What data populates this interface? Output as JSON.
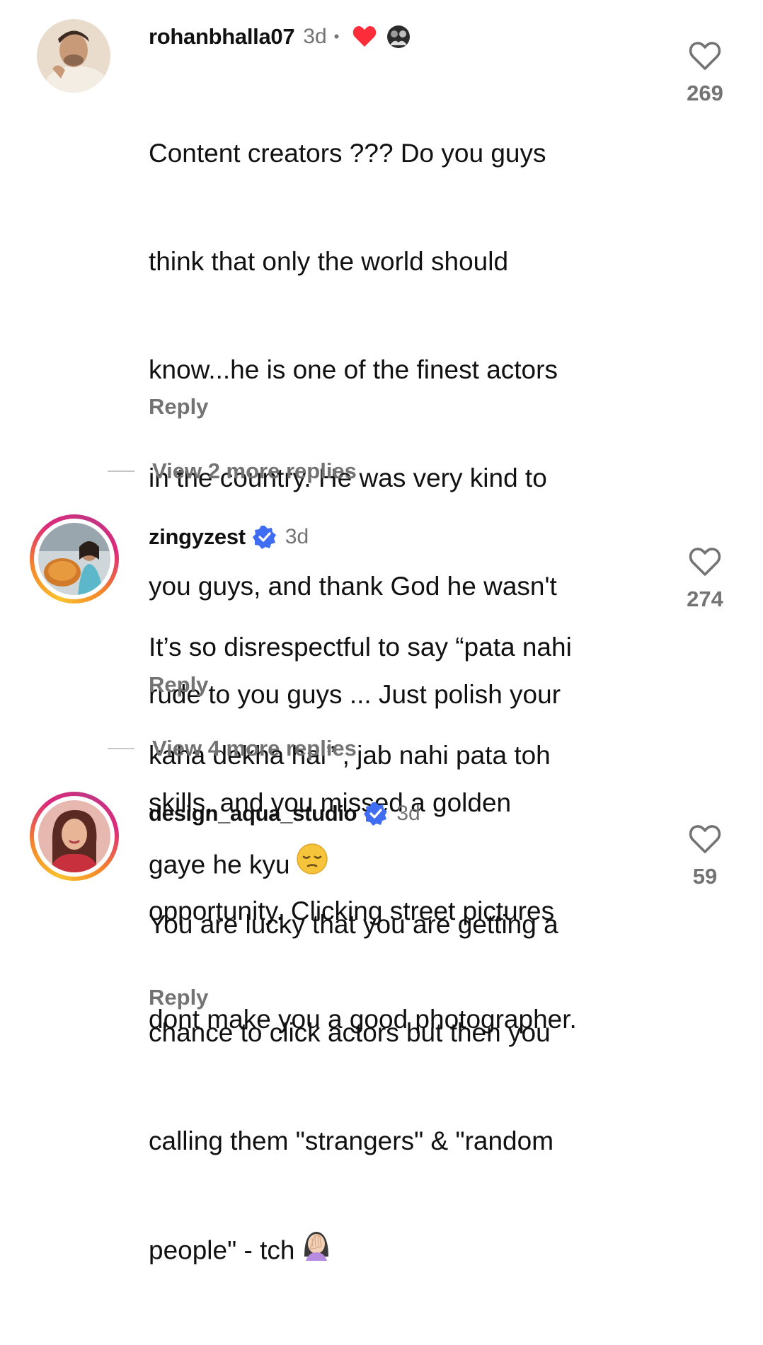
{
  "comments": [
    {
      "username": "rohanbhalla07",
      "time": "3d",
      "dot": "•",
      "lines": [
        "Content creators ??? Do you guys",
        "think that only the world should",
        "know...he is one of the finest actors",
        "in the country. He was very kind to",
        "you guys, and thank God he wasn't",
        "rude to you guys ... Just polish your",
        "skills, and you missed a golden",
        "opportunity. Clicking street pictures",
        "dont make you a good photographer."
      ],
      "reply_label": "Reply",
      "likes": "269",
      "view_replies": "View 2 more replies"
    },
    {
      "username": "zingyzest",
      "time": "3d",
      "lines": [
        "It’s so disrespectful to say “pata nahi",
        "kaha dekha hai” , jab nahi pata toh",
        "gaye he kyu"
      ],
      "emoji": "pensive-face-emoji",
      "reply_label": "Reply",
      "likes": "274",
      "view_replies": "View 4 more replies"
    },
    {
      "username": "design_aqua_studio",
      "time": "3d",
      "lines": [
        "You are lucky that you are getting a",
        "chance to click actors but then you",
        "calling them \"strangers\" & \"random",
        "people\" - tch"
      ],
      "emoji": "woman-facepalming-emoji",
      "reply_label": "Reply",
      "likes": "59"
    }
  ],
  "colors": {
    "text": "#111111",
    "muted": "#737373",
    "verified": "#3f6ef5",
    "heart_red": "#ff2d3a"
  }
}
